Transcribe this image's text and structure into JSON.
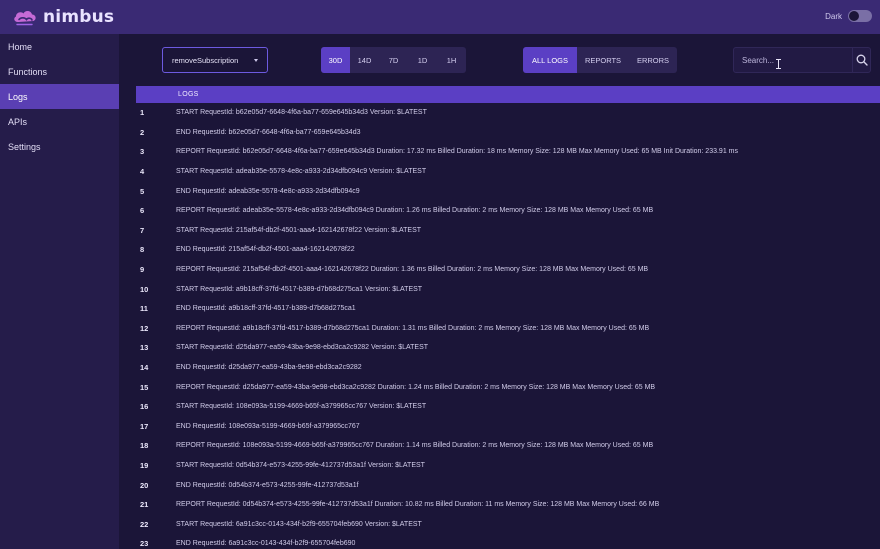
{
  "app": {
    "name": "nimbus"
  },
  "theme": {
    "label": "Dark"
  },
  "colors": {
    "accent": "#5b3fc4",
    "topbar": "#3a2a74",
    "background": "#1b1538",
    "sidebar": "#251c4a"
  },
  "sidebar": {
    "items": [
      {
        "label": "Home"
      },
      {
        "label": "Functions"
      },
      {
        "label": "Logs",
        "active": true
      },
      {
        "label": "APIs"
      },
      {
        "label": "Settings"
      }
    ]
  },
  "function_select": {
    "value": "removeSubscription"
  },
  "time_ranges": [
    {
      "label": "30D",
      "active": true
    },
    {
      "label": "14D"
    },
    {
      "label": "7D"
    },
    {
      "label": "1D"
    },
    {
      "label": "1H"
    }
  ],
  "log_filters": [
    {
      "label": "ALL LOGS",
      "active": true
    },
    {
      "label": "REPORTS"
    },
    {
      "label": "ERRORS"
    }
  ],
  "search": {
    "placeholder": "Search..."
  },
  "logs": {
    "header": "LOGS",
    "rows": [
      {
        "num": "1",
        "text": "START RequestId: b62e05d7-6648-4f6a-ba77-659e645b34d3 Version: $LATEST"
      },
      {
        "num": "2",
        "text": "END RequestId: b62e05d7-6648-4f6a-ba77-659e645b34d3"
      },
      {
        "num": "3",
        "text": "REPORT RequestId: b62e05d7-6648-4f6a-ba77-659e645b34d3 Duration: 17.32 ms Billed Duration: 18 ms Memory Size: 128 MB Max Memory Used: 65 MB Init Duration: 233.91 ms"
      },
      {
        "num": "4",
        "text": "START RequestId: adeab35e-5578-4e8c-a933-2d34dfb094c9 Version: $LATEST"
      },
      {
        "num": "5",
        "text": "END RequestId: adeab35e-5578-4e8c-a933-2d34dfb094c9"
      },
      {
        "num": "6",
        "text": "REPORT RequestId: adeab35e-5578-4e8c-a933-2d34dfb094c9 Duration: 1.26 ms Billed Duration: 2 ms Memory Size: 128 MB Max Memory Used: 65 MB"
      },
      {
        "num": "7",
        "text": "START RequestId: 215af54f-db2f-4501-aaa4-162142678f22 Version: $LATEST"
      },
      {
        "num": "8",
        "text": "END RequestId: 215af54f-db2f-4501-aaa4-162142678f22"
      },
      {
        "num": "9",
        "text": "REPORT RequestId: 215af54f-db2f-4501-aaa4-162142678f22 Duration: 1.36 ms Billed Duration: 2 ms Memory Size: 128 MB Max Memory Used: 65 MB"
      },
      {
        "num": "10",
        "text": "START RequestId: a9b18cff-37fd-4517-b389-d7b68d275ca1 Version: $LATEST"
      },
      {
        "num": "11",
        "text": "END RequestId: a9b18cff-37fd-4517-b389-d7b68d275ca1"
      },
      {
        "num": "12",
        "text": "REPORT RequestId: a9b18cff-37fd-4517-b389-d7b68d275ca1 Duration: 1.31 ms Billed Duration: 2 ms Memory Size: 128 MB Max Memory Used: 65 MB"
      },
      {
        "num": "13",
        "text": "START RequestId: d25da977-ea59-43ba-9e98-ebd3ca2c9282 Version: $LATEST"
      },
      {
        "num": "14",
        "text": "END RequestId: d25da977-ea59-43ba-9e98-ebd3ca2c9282"
      },
      {
        "num": "15",
        "text": "REPORT RequestId: d25da977-ea59-43ba-9e98-ebd3ca2c9282 Duration: 1.24 ms Billed Duration: 2 ms Memory Size: 128 MB Max Memory Used: 65 MB"
      },
      {
        "num": "16",
        "text": "START RequestId: 108e093a-5199-4669-b65f-a379965cc767 Version: $LATEST"
      },
      {
        "num": "17",
        "text": "END RequestId: 108e093a-5199-4669-b65f-a379965cc767"
      },
      {
        "num": "18",
        "text": "REPORT RequestId: 108e093a-5199-4669-b65f-a379965cc767 Duration: 1.14 ms Billed Duration: 2 ms Memory Size: 128 MB Max Memory Used: 65 MB"
      },
      {
        "num": "19",
        "text": "START RequestId: 0d54b374-e573-4255-99fe-412737d53a1f Version: $LATEST"
      },
      {
        "num": "20",
        "text": "END RequestId: 0d54b374-e573-4255-99fe-412737d53a1f"
      },
      {
        "num": "21",
        "text": "REPORT RequestId: 0d54b374-e573-4255-99fe-412737d53a1f Duration: 10.82 ms Billed Duration: 11 ms Memory Size: 128 MB Max Memory Used: 66 MB"
      },
      {
        "num": "22",
        "text": "START RequestId: 6a91c3cc-0143-434f-b2f9-655704feb690 Version: $LATEST"
      },
      {
        "num": "23",
        "text": "END RequestId: 6a91c3cc-0143-434f-b2f9-655704feb690"
      }
    ]
  }
}
